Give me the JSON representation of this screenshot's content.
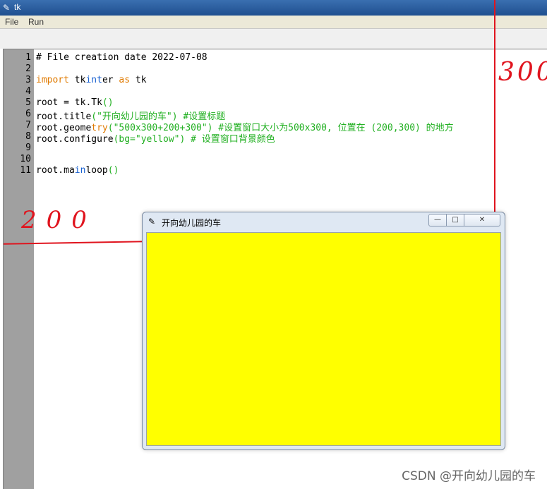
{
  "outer_window": {
    "title": "tk",
    "icon": "feather-icon"
  },
  "menu": {
    "file": "File",
    "run": "Run"
  },
  "editor": {
    "line_numbers": [
      "1",
      "2",
      "3",
      "4",
      "5",
      "6",
      "7",
      "8",
      "9",
      "10",
      "11"
    ],
    "lines": [
      [
        {
          "t": "# File creation date 2022-07-08",
          "c": ""
        }
      ],
      [],
      [
        {
          "t": "import",
          "c": "kw"
        },
        {
          "t": " tk",
          "c": ""
        },
        {
          "t": "int",
          "c": "builtin"
        },
        {
          "t": "er ",
          "c": ""
        },
        {
          "t": "as",
          "c": "kw"
        },
        {
          "t": " tk",
          "c": ""
        }
      ],
      [],
      [
        {
          "t": "root = tk.Tk",
          "c": ""
        },
        {
          "t": "()",
          "c": "str"
        }
      ],
      [
        {
          "t": "root.title",
          "c": ""
        },
        {
          "t": "(\"开向幼儿园的车\")",
          "c": "str"
        },
        {
          "t": " #设置标题",
          "c": "cmt"
        }
      ],
      [
        {
          "t": "root.geome",
          "c": ""
        },
        {
          "t": "try",
          "c": "kw"
        },
        {
          "t": "(\"500x300+200+300\")",
          "c": "str"
        },
        {
          "t": " #设置窗口大小为500x300, 位置在 (200,300) 的地方",
          "c": "cmt"
        }
      ],
      [
        {
          "t": "root.configure",
          "c": ""
        },
        {
          "t": "(bg=\"yellow\")",
          "c": "str"
        },
        {
          "t": " # 设置窗口背景颜色",
          "c": "cmt"
        }
      ],
      [],
      [],
      [
        {
          "t": "root.ma",
          "c": ""
        },
        {
          "t": "in",
          "c": "builtin"
        },
        {
          "t": "loop",
          "c": ""
        },
        {
          "t": "()",
          "c": "str"
        }
      ]
    ]
  },
  "annotations": {
    "left_label": "200",
    "top_label": "300"
  },
  "inner_window": {
    "title": "开向幼儿园的车",
    "icon": "feather-icon",
    "minimize": "—",
    "maximize": "□",
    "close": "✕",
    "background_color": "#ffff00"
  },
  "watermark": "CSDN @开向幼儿园的车"
}
